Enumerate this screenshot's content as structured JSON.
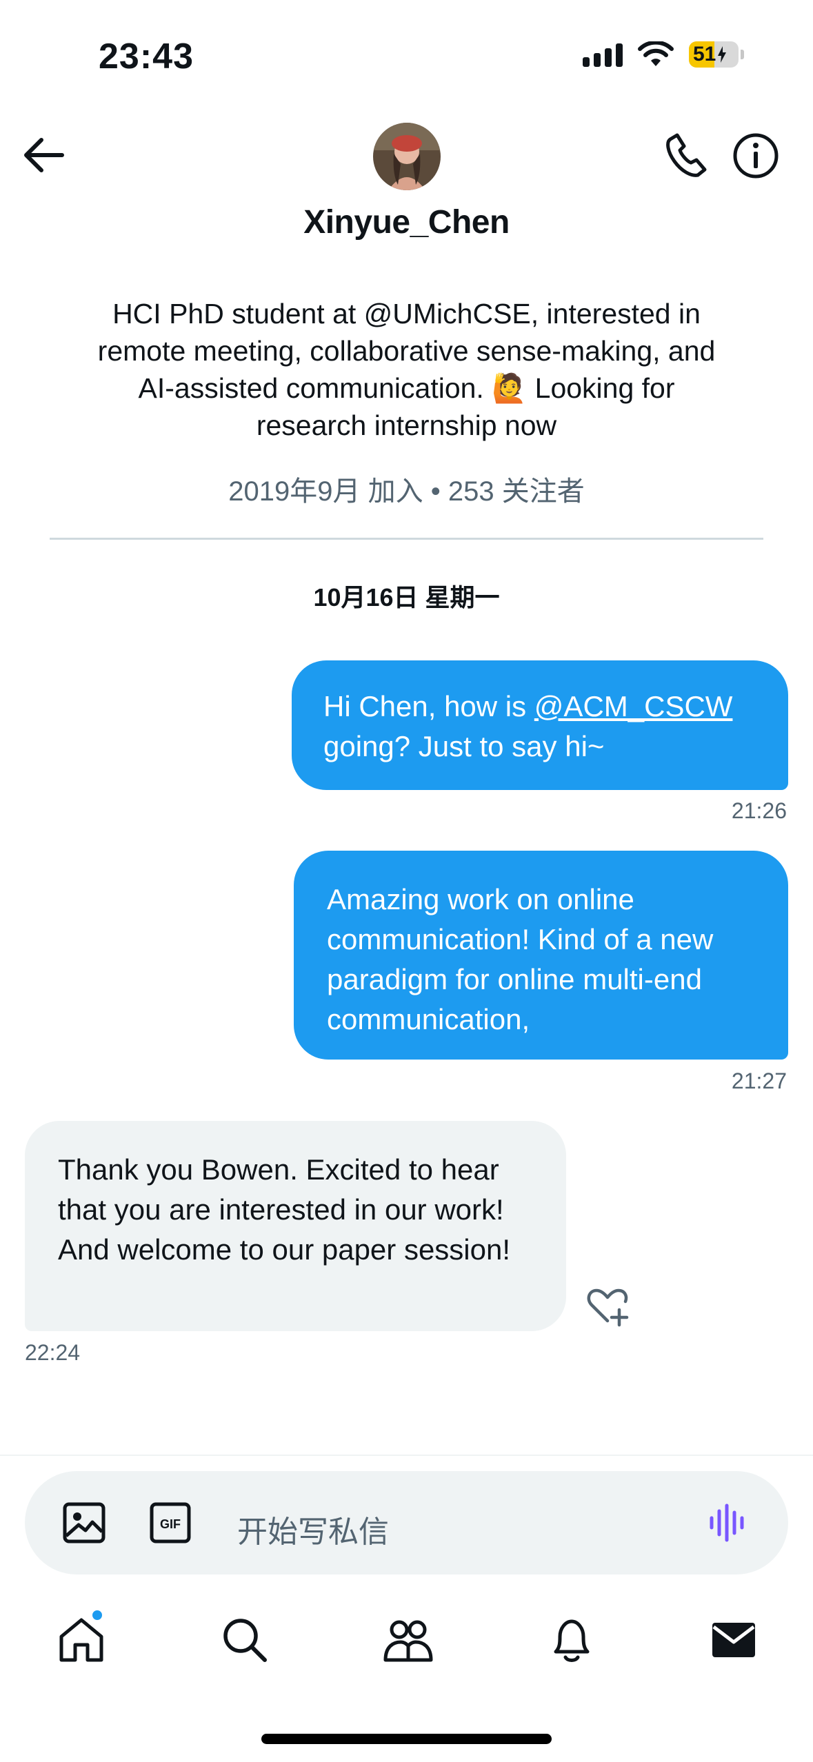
{
  "status_bar": {
    "time": "23:43",
    "battery": "51",
    "battery_level": 0.51,
    "icons": [
      "signal-icon",
      "wifi-icon",
      "battery-charging-icon"
    ]
  },
  "header": {
    "display_name": "Xinyue_Chen",
    "icons": [
      "back-arrow-icon",
      "phone-icon",
      "info-icon"
    ]
  },
  "profile": {
    "bio_lines": [
      "HCI PhD student at @UMichCSE, interested in",
      "remote meeting, collaborative sense-making, and",
      "AI-assisted communication. 🙋 Looking for",
      "research internship now"
    ],
    "meta": "2019年9月 加入 • 253 关注者"
  },
  "conversation": {
    "date_label": "10月16日 星期一",
    "messages": [
      {
        "direction": "outgoing",
        "text_before": "Hi Chen, how is ",
        "mention": "@ACM_CSCW",
        "text_after": " going? Just to say hi~",
        "time": "21:26"
      },
      {
        "direction": "outgoing",
        "text": "Amazing work on online communication! Kind of a new paradigm for online multi-end communication,",
        "time": "21:27"
      },
      {
        "direction": "incoming",
        "text": "Thank you Bowen. Excited to hear that you are interested in our work! And welcome to our paper session!",
        "time": "22:24"
      }
    ]
  },
  "composer": {
    "placeholder": "开始写私信",
    "icons": [
      "image-icon",
      "gif-icon",
      "voice-wave-icon"
    ]
  },
  "tab_bar": {
    "tabs": [
      "home-icon",
      "search-icon",
      "communities-icon",
      "notifications-bell-icon",
      "messages-envelope-icon"
    ],
    "active": "messages",
    "home_has_new": true
  },
  "colors": {
    "accent": "#1d9bf0",
    "incoming_bubble": "#eff3f4",
    "secondary_text": "#536471",
    "battery_yellow": "#f7c600",
    "voice_purple": "#7856ff"
  }
}
